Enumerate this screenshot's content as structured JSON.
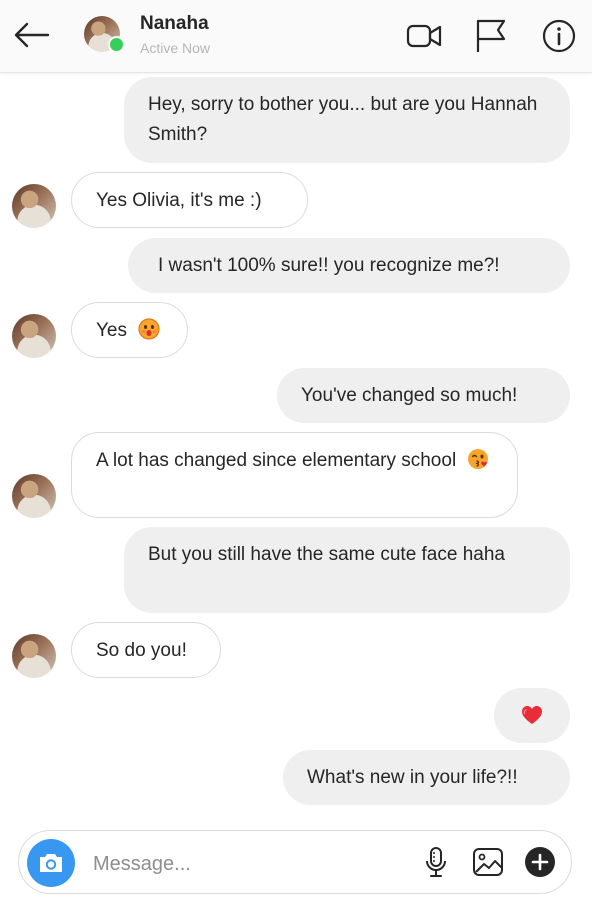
{
  "header": {
    "contact_name": "Nanaha",
    "status": "Active Now"
  },
  "messages": [
    {
      "from": "me",
      "text": "Hey, sorry to bother you... but are you Hannah Smith?"
    },
    {
      "from": "them",
      "text": "Yes Olivia, it's me :)"
    },
    {
      "from": "me",
      "text": "I wasn't 100% sure!! you recognize me?!"
    },
    {
      "from": "them",
      "text": "Yes",
      "emoji": "hushed-face"
    },
    {
      "from": "me",
      "text": "You've changed so much!"
    },
    {
      "from": "them",
      "text": "A lot has changed since elementary school",
      "emoji": "face-blowing-kiss"
    },
    {
      "from": "me",
      "text": "But you still have the same cute face haha"
    },
    {
      "from": "them",
      "text": "So do you!"
    },
    {
      "from": "me",
      "emoji": "red-heart"
    },
    {
      "from": "me",
      "text": "What's new in your life?!!"
    }
  ],
  "composer": {
    "placeholder": "Message..."
  },
  "colors": {
    "accent": "#3897f0",
    "online": "#35d05a",
    "outgoing_bubble": "#efefef",
    "incoming_border": "#dbdbdb"
  }
}
